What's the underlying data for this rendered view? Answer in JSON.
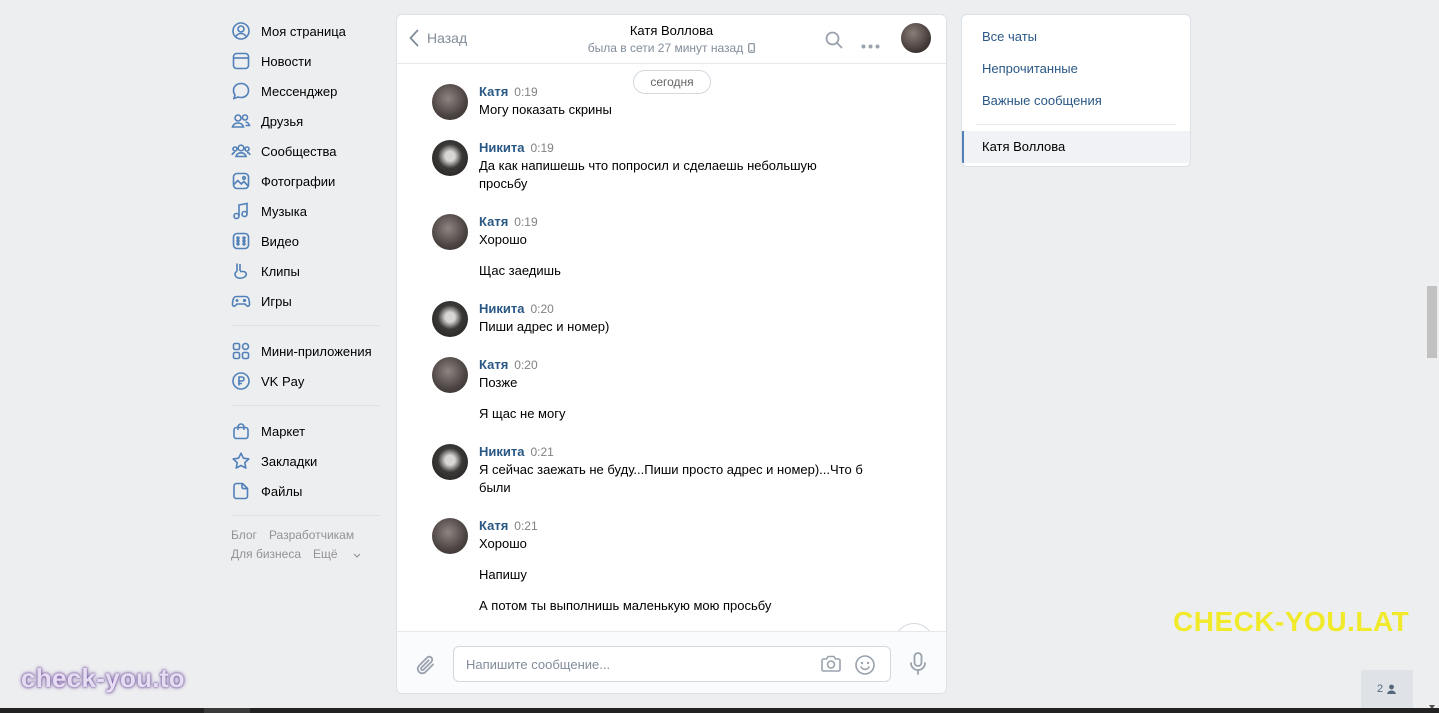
{
  "nav": {
    "items": [
      {
        "label": "Моя страница",
        "icon": "user-circle-icon"
      },
      {
        "label": "Новости",
        "icon": "newspaper-icon"
      },
      {
        "label": "Мессенджер",
        "icon": "chat-bubble-icon"
      },
      {
        "label": "Друзья",
        "icon": "friends-icon"
      },
      {
        "label": "Сообщества",
        "icon": "communities-icon"
      },
      {
        "label": "Фотографии",
        "icon": "photo-icon"
      },
      {
        "label": "Музыка",
        "icon": "music-note-icon"
      },
      {
        "label": "Видео",
        "icon": "video-icon"
      },
      {
        "label": "Клипы",
        "icon": "clips-icon"
      },
      {
        "label": "Игры",
        "icon": "gamepad-icon"
      }
    ],
    "items2": [
      {
        "label": "Мини-приложения",
        "icon": "apps-icon"
      },
      {
        "label": "VK Pay",
        "icon": "vkpay-icon"
      }
    ],
    "items3": [
      {
        "label": "Маркет",
        "icon": "shopping-bag-icon"
      },
      {
        "label": "Закладки",
        "icon": "star-icon"
      },
      {
        "label": "Файлы",
        "icon": "file-icon"
      }
    ],
    "footer": {
      "blog": "Блог",
      "developers": "Разработчикам",
      "business": "Для бизнеса",
      "more": "Ещё"
    }
  },
  "chat": {
    "back_label": "Назад",
    "peer_name": "Катя Воллова",
    "peer_status": "была в сети 27 минут назад",
    "date_label": "сегодня",
    "messages": [
      {
        "author": "Катя",
        "time": "0:19",
        "lines": [
          "Могу показать скрины"
        ]
      },
      {
        "author": "Никита",
        "time": "0:19",
        "lines": [
          "Да как напишешь что попросил и сделаешь небольшую просьбу"
        ]
      },
      {
        "author": "Катя",
        "time": "0:19",
        "lines": [
          "Хорошо",
          "Щас заедишь"
        ]
      },
      {
        "author": "Никита",
        "time": "0:20",
        "lines": [
          "Пиши адрес и номер)"
        ]
      },
      {
        "author": "Катя",
        "time": "0:20",
        "lines": [
          "Позже",
          "Я щас не могу"
        ]
      },
      {
        "author": "Никита",
        "time": "0:21",
        "lines": [
          "Я сейчас заежать не буду...Пиши просто адрес и номер)...Что б были"
        ]
      },
      {
        "author": "Катя",
        "time": "0:21",
        "lines": [
          "Хорошо",
          "Напишу",
          "А потом ты выполнишь маленькую мою просьбу"
        ]
      }
    ],
    "input_placeholder": "Напишите сообщение..."
  },
  "right_panel": {
    "all_chats": "Все чаты",
    "unread": "Непрочитанные",
    "important": "Важные сообщения",
    "active_chat": "Катя Воллова"
  },
  "online_count": "2",
  "watermarks": {
    "left": "check-you.to",
    "right": "CHECK-YOU.LAT"
  },
  "colors": {
    "link": "#2a5885",
    "accent": "#5181b8",
    "background": "#edeef0",
    "watermark_right": "#f1ea2a"
  }
}
